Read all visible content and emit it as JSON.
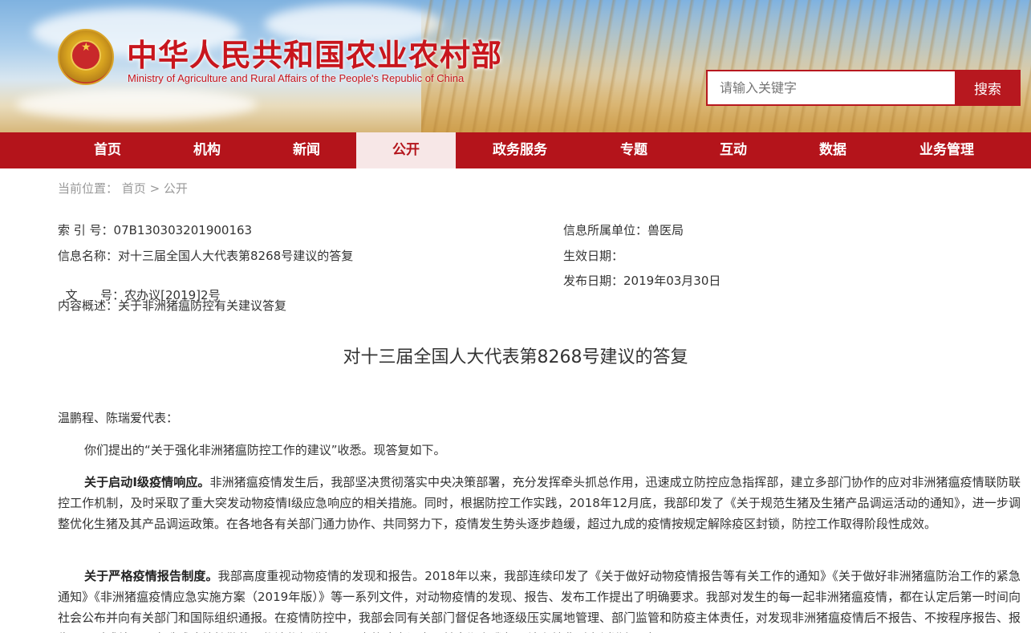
{
  "header": {
    "title": "中华人民共和国农业农村部",
    "subtitle": "Ministry of Agriculture and Rural Affairs of the People's Republic of China",
    "search_placeholder": "请输入关键字",
    "search_button": "搜索"
  },
  "nav": {
    "items": [
      {
        "label": "首页"
      },
      {
        "label": "机构"
      },
      {
        "label": "新闻"
      },
      {
        "label": "公开"
      },
      {
        "label": "政务服务"
      },
      {
        "label": "专题"
      },
      {
        "label": "互动"
      },
      {
        "label": "数据"
      },
      {
        "label": "业务管理"
      }
    ],
    "active_color": "#b4141b"
  },
  "breadcrumb": {
    "prefix": "当前位置：",
    "home": "首页",
    "sep": " > ",
    "current": "公开"
  },
  "meta": {
    "index_label": "索 引 号：",
    "index_value": "07B130303201900163",
    "name_label": "信息名称：",
    "name_value": "对十三届全国人大代表第8268号建议的答复",
    "doc_label": "文      号：",
    "doc_value": "农办议[2019]2号",
    "summary_label": "内容概述：",
    "summary_value": "关于非洲猪瘟防控有关建议答复",
    "unit_label": "信息所属单位：",
    "unit_value": "兽医局",
    "effective_label": "生效日期：",
    "effective_value": "",
    "publish_label": "发布日期：",
    "publish_value": "2019年03月30日"
  },
  "document": {
    "title": "对十三届全国人大代表第8268号建议的答复",
    "salutation": "温鹏程、陈瑞爱代表：",
    "intro": "你们提出的“关于强化非洲猪瘟防控工作的建议”收悉。现答复如下。",
    "p1_head": "关于启动I级疫情响应。",
    "p1_body": "非洲猪瘟疫情发生后，我部坚决贯彻落实中央决策部署，充分发挥牵头抓总作用，迅速成立防控应急指挥部，建立多部门协作的应对非洲猪瘟疫情联防联控工作机制，及时采取了重大突发动物疫情I级应急响应的相关措施。同时，根据防控工作实践，2018年12月底，我部印发了《关于规范生猪及生猪产品调运活动的通知》，进一步调整优化生猪及其产品调运政策。在各地各有关部门通力协作、共同努力下，疫情发生势头逐步趋缓，超过九成的疫情按规定解除疫区封锁，防控工作取得阶段性成效。",
    "p2_head": "关于严格疫情报告制度。",
    "p2_body": "我部高度重视动物疫情的发现和报告。2018年以来，我部连续印发了《关于做好动物疫情报告等有关工作的通知》《关于做好非洲猪瘟防治工作的紧急通知》《非洲猪瘟疫情应急实施方案（2019年版）》等一系列文件，对动物疫情的发现、报告、发布工作提出了明确要求。我部对发生的每一起非洲猪瘟疫情，都在认定后第一时间向社会公布并向有关部门和国际组织通报。在疫情防控中，我部会同有关部门督促各地逐级压实属地管理、部门监管和防疫主体责任，对发现非洲猪瘟疫情后不报告、不按程序报告、报告不及时或处置不力造成疫情扩散的，依法依规进行了严肃的追责问责，并定期在我部网站上就典型案例进行通报。"
  }
}
